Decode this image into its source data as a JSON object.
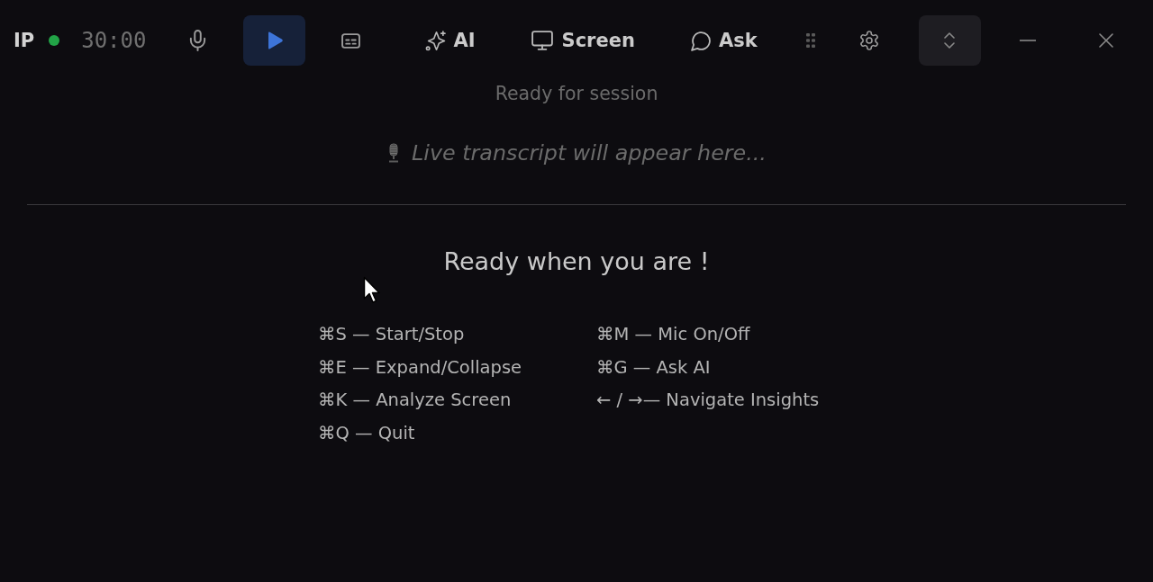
{
  "header": {
    "brand": "IP",
    "connected": true,
    "timer": "30:00"
  },
  "toolbar": {
    "actions": [
      {
        "label": "AI"
      },
      {
        "label": "Screen"
      },
      {
        "label": "Ask"
      }
    ],
    "expand_pressed": true
  },
  "content": {
    "status": "Ready for session",
    "transcript_empty_text": "Live transcript will appear here...",
    "heading": "Ready when you are !",
    "shortcut_columns": [
      [
        "⌘S — Start/Stop",
        "⌘E — Expand/Collapse",
        "⌘K — Analyze Screen",
        "⌘Q — Quit"
      ],
      [
        "⌘M — Mic On/Off",
        "⌘G — Ask AI",
        "← / →— Navigate Insights"
      ]
    ]
  }
}
